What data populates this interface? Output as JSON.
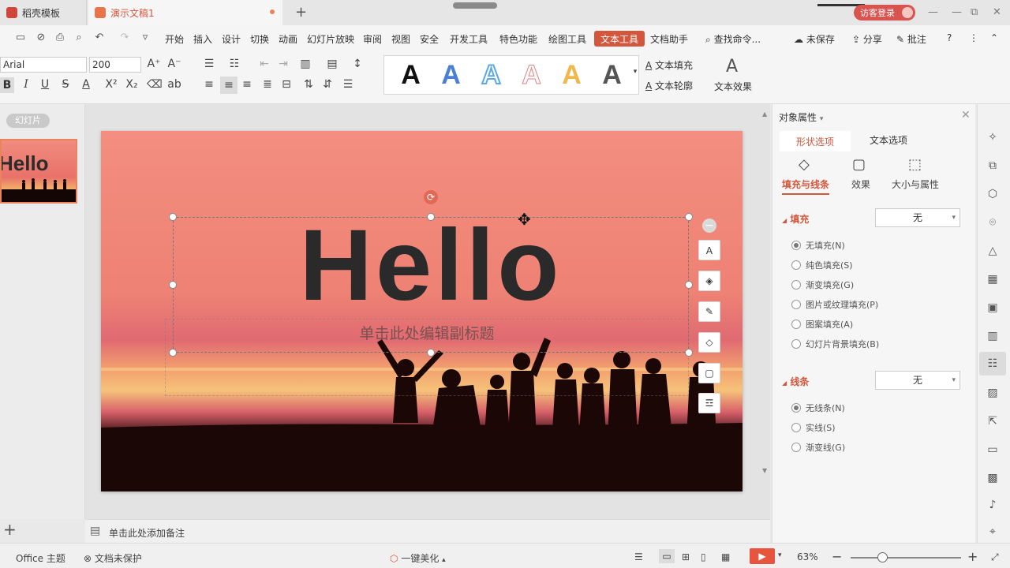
{
  "titlebar": {
    "tabs": [
      {
        "label": "稻壳模板"
      },
      {
        "label": "演示文稿1"
      }
    ],
    "new_tab": "+",
    "login": "访客登录",
    "win_min": "—",
    "win_max": "⧉",
    "win_close": "✕"
  },
  "menubar": {
    "items": [
      "开始",
      "插入",
      "设计",
      "切换",
      "动画",
      "幻灯片放映",
      "审阅",
      "视图",
      "安全",
      "开发工具",
      "特色功能",
      "绘图工具",
      "文本工具",
      "文档助手"
    ],
    "active": "文本工具",
    "search": "查找命令...",
    "unsaved": "未保存",
    "share": "分享",
    "annotate": "批注"
  },
  "ribbon": {
    "font_name": "Arial",
    "font_size": "200",
    "text_fill": "文本填充",
    "text_outline": "文本轮廓",
    "text_effect": "文本效果",
    "style_letters": [
      "A",
      "A",
      "A",
      "A",
      "A",
      "A"
    ],
    "style_colors": [
      "#111111",
      "#4a7fd4",
      "#5aa9e6",
      "#f0a6a6",
      "#f2b64a",
      "#555555"
    ]
  },
  "left": {
    "slides_tag": "幻灯片",
    "thumb_text": "Hello",
    "add": "+"
  },
  "slide": {
    "title": "Hello",
    "subtitle": "单击此处编辑副标题"
  },
  "notes": {
    "placeholder": "单击此处添加备注"
  },
  "props": {
    "header": "对象属性",
    "tab_shape": "形状选项",
    "tab_text": "文本选项",
    "sub_fill_line": "填充与线条",
    "sub_effect": "效果",
    "sub_size": "大小与属性",
    "fill_title": "填充",
    "fill_value": "无",
    "fill_options": [
      "无填充(N)",
      "纯色填充(S)",
      "渐变填充(G)",
      "图片或纹理填充(P)",
      "图案填充(A)",
      "幻灯片背景填充(B)"
    ],
    "line_title": "线条",
    "line_value": "无",
    "line_options": [
      "无线条(N)",
      "实线(S)",
      "渐变线(G)"
    ]
  },
  "status": {
    "theme": "Office 主题",
    "protect": "文档未保护",
    "beautify": "一键美化",
    "zoom": "63%"
  },
  "colors": {
    "accent": "#d2573c",
    "slide_top": "#f28b7e",
    "slide_mid": "#e8726a"
  }
}
